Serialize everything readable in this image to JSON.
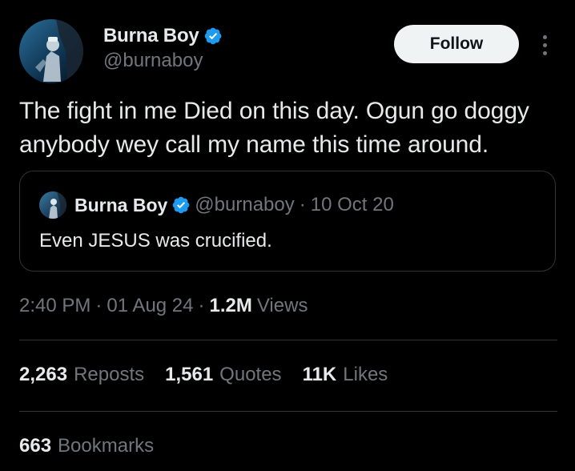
{
  "author": {
    "display_name": "Burna Boy",
    "handle": "@burnaboy",
    "verified": true
  },
  "actions": {
    "follow_label": "Follow",
    "more_icon": "more-vertical-icon"
  },
  "tweet": {
    "text": "The fight in me Died on this day. Ogun go doggy anybody wey call my name this time around."
  },
  "quoted": {
    "display_name": "Burna Boy",
    "handle": "@burnaboy",
    "separator": "·",
    "date": "10 Oct 20",
    "text": "Even JESUS was crucified."
  },
  "meta": {
    "time": "2:40 PM",
    "separator": "·",
    "date": "01 Aug 24",
    "views_count": "1.2M",
    "views_label": "Views"
  },
  "stats": {
    "reposts_count": "2,263",
    "reposts_label": "Reposts",
    "quotes_count": "1,561",
    "quotes_label": "Quotes",
    "likes_count": "11K",
    "likes_label": "Likes",
    "bookmarks_count": "663",
    "bookmarks_label": "Bookmarks"
  },
  "colors": {
    "background": "#000000",
    "primary_text": "#e7e9ea",
    "secondary_text": "#71767b",
    "border": "#2f3336",
    "verified_blue": "#1d9bf0",
    "follow_bg": "#eff3f4"
  }
}
